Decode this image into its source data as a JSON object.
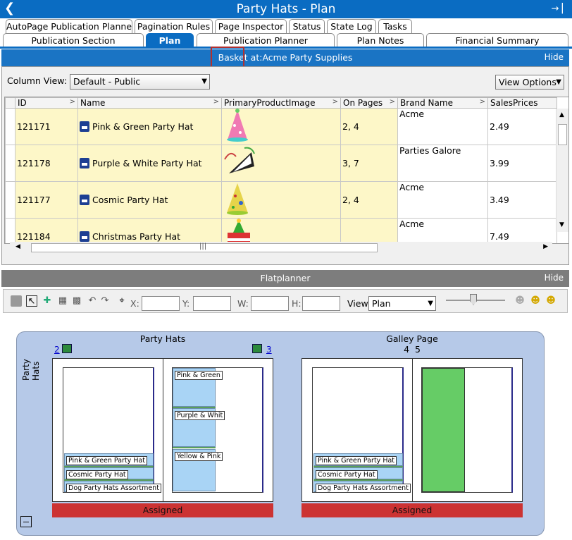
{
  "titlebar": {
    "title": "Party Hats - Plan"
  },
  "tabs_row1": [
    "AutoPage Publication Planner",
    "Pagination Rules",
    "Page Inspector",
    "Status",
    "State Log",
    "Tasks"
  ],
  "tabs_row2": [
    "Publication Section",
    "Plan",
    "Publication Planner",
    "Plan Notes",
    "Financial Summary"
  ],
  "basket": {
    "title": "Basket at:Acme Party Supplies",
    "hide": "Hide"
  },
  "column_view": {
    "label": "Column View:",
    "value": "Default - Public",
    "view_options": "View Options"
  },
  "table": {
    "headers": [
      "ID",
      "Name",
      "PrimaryProductImage",
      "On Pages",
      "Brand Name",
      "SalesPrices"
    ],
    "rows": [
      {
        "id": "121171",
        "name": "Pink & Green Party Hat",
        "pages": "2, 4",
        "brand": "Acme",
        "price": "2.49"
      },
      {
        "id": "121178",
        "name": "Purple & White Party Hat",
        "pages": "3, 7",
        "brand": "Parties Galore",
        "price": "3.99"
      },
      {
        "id": "121177",
        "name": "Cosmic Party Hat",
        "pages": "2, 4",
        "brand": "Acme",
        "price": "3.49"
      },
      {
        "id": "121184",
        "name": "Christmas Party Hat",
        "pages": "",
        "brand": "Acme",
        "price": "7.49"
      }
    ]
  },
  "flatplanner": {
    "title": "Flatplanner",
    "hide": "Hide"
  },
  "toolbar": {
    "x_label": "X:",
    "y_label": "Y:",
    "w_label": "W:",
    "h_label": "H:",
    "view_label": "View",
    "view_value": "Plan"
  },
  "spreads": [
    {
      "title": "Party Hats",
      "left_page": "2",
      "right_page": "3",
      "status": "Assigned"
    },
    {
      "title": "Galley Page",
      "pages": "4  5",
      "status": "Assigned"
    }
  ],
  "side_label": "Party Hats",
  "left_page_items": [
    "Pink & Green Party Hat",
    "Cosmic Party Hat",
    "Dog Party Hats Assortment"
  ],
  "right_page_items": [
    "Pink & Green",
    "Purple & Whit",
    "Yellow & Pink"
  ],
  "galley_items": [
    "Pink & Green Party Hat",
    "Cosmic Party Hat",
    "Dog Party Hats Assortment"
  ],
  "colors": {
    "accent": "#0a6cc2",
    "header_band": "#1a74c4",
    "flat_band": "#7d7d7d",
    "assigned": "#cc3333",
    "spread_bg": "#b6c9e8",
    "galley_green": "#66cc66"
  }
}
